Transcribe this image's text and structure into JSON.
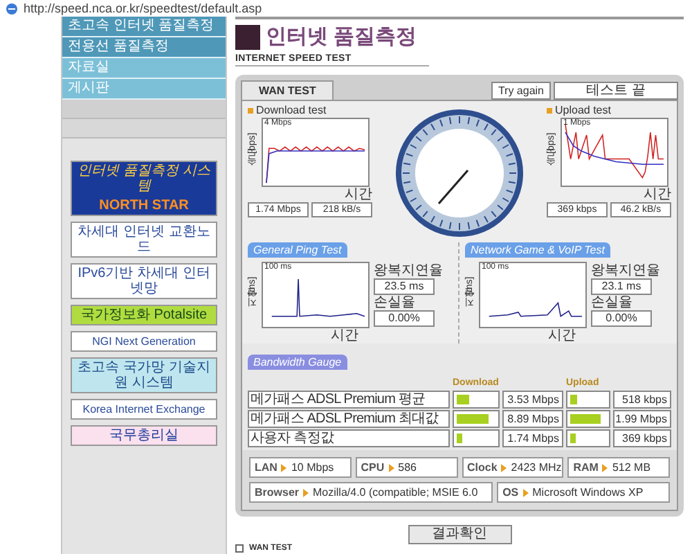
{
  "address_bar": {
    "url": "http://speed.nca.or.kr/speedtest/default.asp"
  },
  "sidebar": {
    "menu": [
      {
        "label": "초고속 인터넷 품질측정"
      },
      {
        "label": "전용선 품질측정"
      },
      {
        "label": "자료실"
      },
      {
        "label": "게시판"
      }
    ],
    "banners": [
      {
        "kind": "feature",
        "text": "인터넷 품질측정 시스템",
        "subtext": "NORTH STAR"
      },
      {
        "kind": "plain",
        "text": "차세대 인터넷 교환노드"
      },
      {
        "kind": "plain",
        "text": "IPv6기반 차세대 인터넷망"
      },
      {
        "kind": "green",
        "text": "국가정보화 Potalsite"
      },
      {
        "kind": "plain",
        "text": "NGI Next Generation"
      },
      {
        "kind": "teal",
        "text": "초고속 국가망 기술지원 시스템"
      },
      {
        "kind": "plain",
        "text": "Korea Internet Exchange"
      },
      {
        "kind": "pink",
        "text": "국무총리실"
      }
    ]
  },
  "header": {
    "title": "인터넷 품질측정",
    "subtitle": "INTERNET SPEED TEST"
  },
  "panel": {
    "tab": "WAN TEST",
    "try_again": "Try again",
    "status": "테스트 끝",
    "download": {
      "label": "Download test",
      "scale": "4 Mbps",
      "y_label": "속도[bps]",
      "x_label": "시간",
      "readings": [
        "1.74 Mbps",
        "218 kB/s"
      ]
    },
    "upload": {
      "label": "Upload test",
      "scale": "1 Mbps",
      "y_label": "속도[bps]",
      "x_label": "시간",
      "readings": [
        "369 kbps",
        "46.2 kB/s"
      ]
    },
    "ping_sections": [
      {
        "title": "General Ping Test",
        "scale": "100 ms",
        "y_label": "지연[ms]",
        "x_label": "시간",
        "delay_label": "왕복지연율",
        "delay": "23.5 ms",
        "loss_label": "손실율",
        "loss": "0.00%"
      },
      {
        "title": "Network Game & VoIP Test",
        "scale": "100 ms",
        "y_label": "지연[ms]",
        "x_label": "시간",
        "delay_label": "왕복지연율",
        "delay": "23.1 ms",
        "loss_label": "손실율",
        "loss": "0.00%"
      }
    ],
    "bandwidth": {
      "title": "Bandwidth Gauge",
      "download_header": "Download",
      "upload_header": "Upload",
      "rows": [
        {
          "label": "메가패스 ADSL Premium 평균",
          "download": {
            "level": 0.33,
            "value": "3.53 Mbps"
          },
          "upload": {
            "level": 0.2,
            "value": "518 kbps"
          }
        },
        {
          "label": "메가패스 ADSL Premium 최대값",
          "download": {
            "level": 0.83,
            "value": "8.89 Mbps"
          },
          "upload": {
            "level": 0.86,
            "value": "1.99 Mbps"
          }
        },
        {
          "label": "사용자 측정값",
          "download": {
            "level": 0.14,
            "value": "1.74 Mbps"
          },
          "upload": {
            "level": 0.16,
            "value": "369 kbps"
          }
        }
      ]
    },
    "system": [
      {
        "label": "LAN",
        "value": "10 Mbps"
      },
      {
        "label": "CPU",
        "value": "586"
      },
      {
        "label": "Clock",
        "value": "2423 MHz"
      },
      {
        "label": "RAM",
        "value": "512 MB"
      },
      {
        "label": "Browser",
        "value": "Mozilla/4.0 (compatible; MSIE 6.0"
      },
      {
        "label": "OS",
        "value": "Microsoft Windows XP"
      }
    ]
  },
  "result_button": "결과확인",
  "footer": {
    "label": "WAN TEST"
  }
}
